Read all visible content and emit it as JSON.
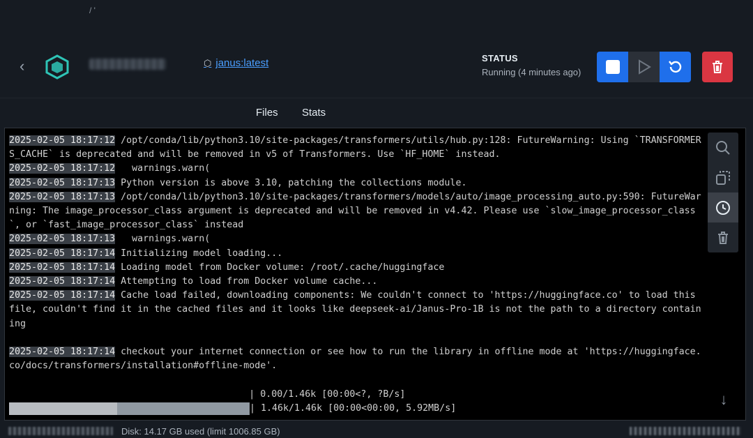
{
  "header": {
    "back_icon": "chevron-left-icon",
    "logo_icon": "container-box-icon",
    "image_tag": "janus:latest",
    "status_label": "STATUS",
    "status_value": "Running (4 minutes ago)"
  },
  "controls": {
    "stop_icon": "stop-icon",
    "play_icon": "play-icon",
    "restart_icon": "restart-icon",
    "delete_icon": "trash-icon"
  },
  "tabs": [
    {
      "label": "Files"
    },
    {
      "label": "Stats"
    }
  ],
  "log": {
    "lines": [
      {
        "ts": "2025-02-05 18:17:12",
        "text": " /opt/conda/lib/python3.10/site-packages/transformers/utils/hub.py:128: FutureWarning: Using `TRANSFORMERS_CACHE` is deprecated and will be removed in v5 of Transformers. Use `HF_HOME` instead."
      },
      {
        "ts": "2025-02-05 18:17:12",
        "text": "   warnings.warn("
      },
      {
        "ts": "2025-02-05 18:17:13",
        "text": " Python version is above 3.10, patching the collections module."
      },
      {
        "ts": "2025-02-05 18:17:13",
        "text": " /opt/conda/lib/python3.10/site-packages/transformers/models/auto/image_processing_auto.py:590: FutureWarning: The image_processor_class argument is deprecated and will be removed in v4.42. Please use `slow_image_processor_class`, or `fast_image_processor_class` instead"
      },
      {
        "ts": "2025-02-05 18:17:13",
        "text": "   warnings.warn("
      },
      {
        "ts": "2025-02-05 18:17:14",
        "text": " Initializing model loading..."
      },
      {
        "ts": "2025-02-05 18:17:14",
        "text": " Loading model from Docker volume: /root/.cache/huggingface"
      },
      {
        "ts": "2025-02-05 18:17:14",
        "text": " Attempting to load from Docker volume cache..."
      },
      {
        "ts": "2025-02-05 18:17:14",
        "text": " Cache load failed, downloading components: We couldn't connect to 'https://huggingface.co' to load this file, couldn't find it in the cached files and it looks like deepseek-ai/Janus-Pro-1B is not the path to a directory containing"
      },
      {
        "ts": "",
        "text": ""
      },
      {
        "ts": "2025-02-05 18:17:14",
        "text": " checkout your internet connection or see how to run the library in offline mode at 'https://huggingface.co/docs/transformers/installation#offline-mode'."
      },
      {
        "ts": "",
        "text": ""
      },
      {
        "ts": "",
        "text": "                                           | 0.00/1.46k [00:00<?, ?B/s]"
      }
    ],
    "progress_text": "| 1.46k/1.46k [00:00<00:00, 5.92MB/s]",
    "progress_fraction": 1.0
  },
  "side_tools": {
    "search_icon": "search-icon",
    "copy_icon": "copy-icon",
    "clock_icon": "clock-icon",
    "trash_icon": "trash-icon",
    "scroll_down_icon": "arrow-down-icon"
  },
  "footer": {
    "disk": "Disk: 14.17 GB used (limit 1006.85 GB)"
  },
  "colors": {
    "accent": "#1f6feb",
    "danger": "#da3642",
    "background": "#161b22",
    "log_background": "#000000"
  }
}
